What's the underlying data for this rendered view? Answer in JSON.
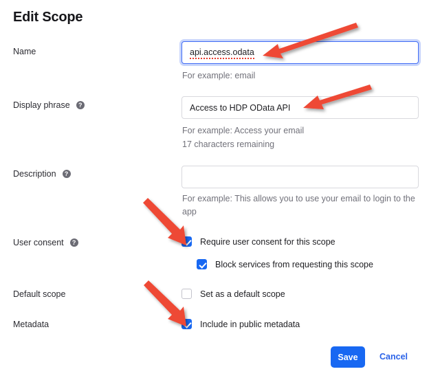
{
  "page_title": "Edit Scope",
  "help_icon_glyph": "?",
  "fields": {
    "name": {
      "label": "Name",
      "value": "api.access.odata",
      "hint": "For example: email",
      "focused": true,
      "spellcheck_underline": true
    },
    "display_phrase": {
      "label": "Display phrase",
      "value": "Access to HDP OData API",
      "hint": "For example: Access your email",
      "counter": "17 characters remaining",
      "help": true
    },
    "description": {
      "label": "Description",
      "value": "",
      "placeholder": "",
      "hint": "For example: This allows you to use your email to login to the app",
      "help": true
    }
  },
  "checkbox_groups": [
    {
      "label": "User consent",
      "help": true,
      "items": [
        {
          "label": "Require user consent for this scope",
          "checked": true,
          "nested": false
        },
        {
          "label": "Block services from requesting this scope",
          "checked": true,
          "nested": true
        }
      ]
    },
    {
      "label": "Default scope",
      "help": false,
      "items": [
        {
          "label": "Set as a default scope",
          "checked": false,
          "nested": false
        }
      ]
    },
    {
      "label": "Metadata",
      "help": false,
      "items": [
        {
          "label": "Include in public metadata",
          "checked": true,
          "nested": false
        }
      ]
    }
  ],
  "actions": {
    "save_label": "Save",
    "cancel_label": "Cancel"
  },
  "colors": {
    "accent_blue": "#1868f2",
    "link_blue": "#2a62e8",
    "annotation_red": "#ee4a36",
    "focus_ring": "#c8d5fb",
    "border_gray": "#d8d8dd",
    "hint_gray": "#71717a"
  },
  "annotations": [
    {
      "name": "arrow-to-name-field",
      "target": "name-input"
    },
    {
      "name": "arrow-to-display-phrase-field",
      "target": "display-phrase-input"
    },
    {
      "name": "arrow-to-require-consent-checkbox",
      "target": "require-user-consent-checkbox"
    },
    {
      "name": "arrow-to-include-metadata-checkbox",
      "target": "include-public-metadata-checkbox"
    }
  ]
}
